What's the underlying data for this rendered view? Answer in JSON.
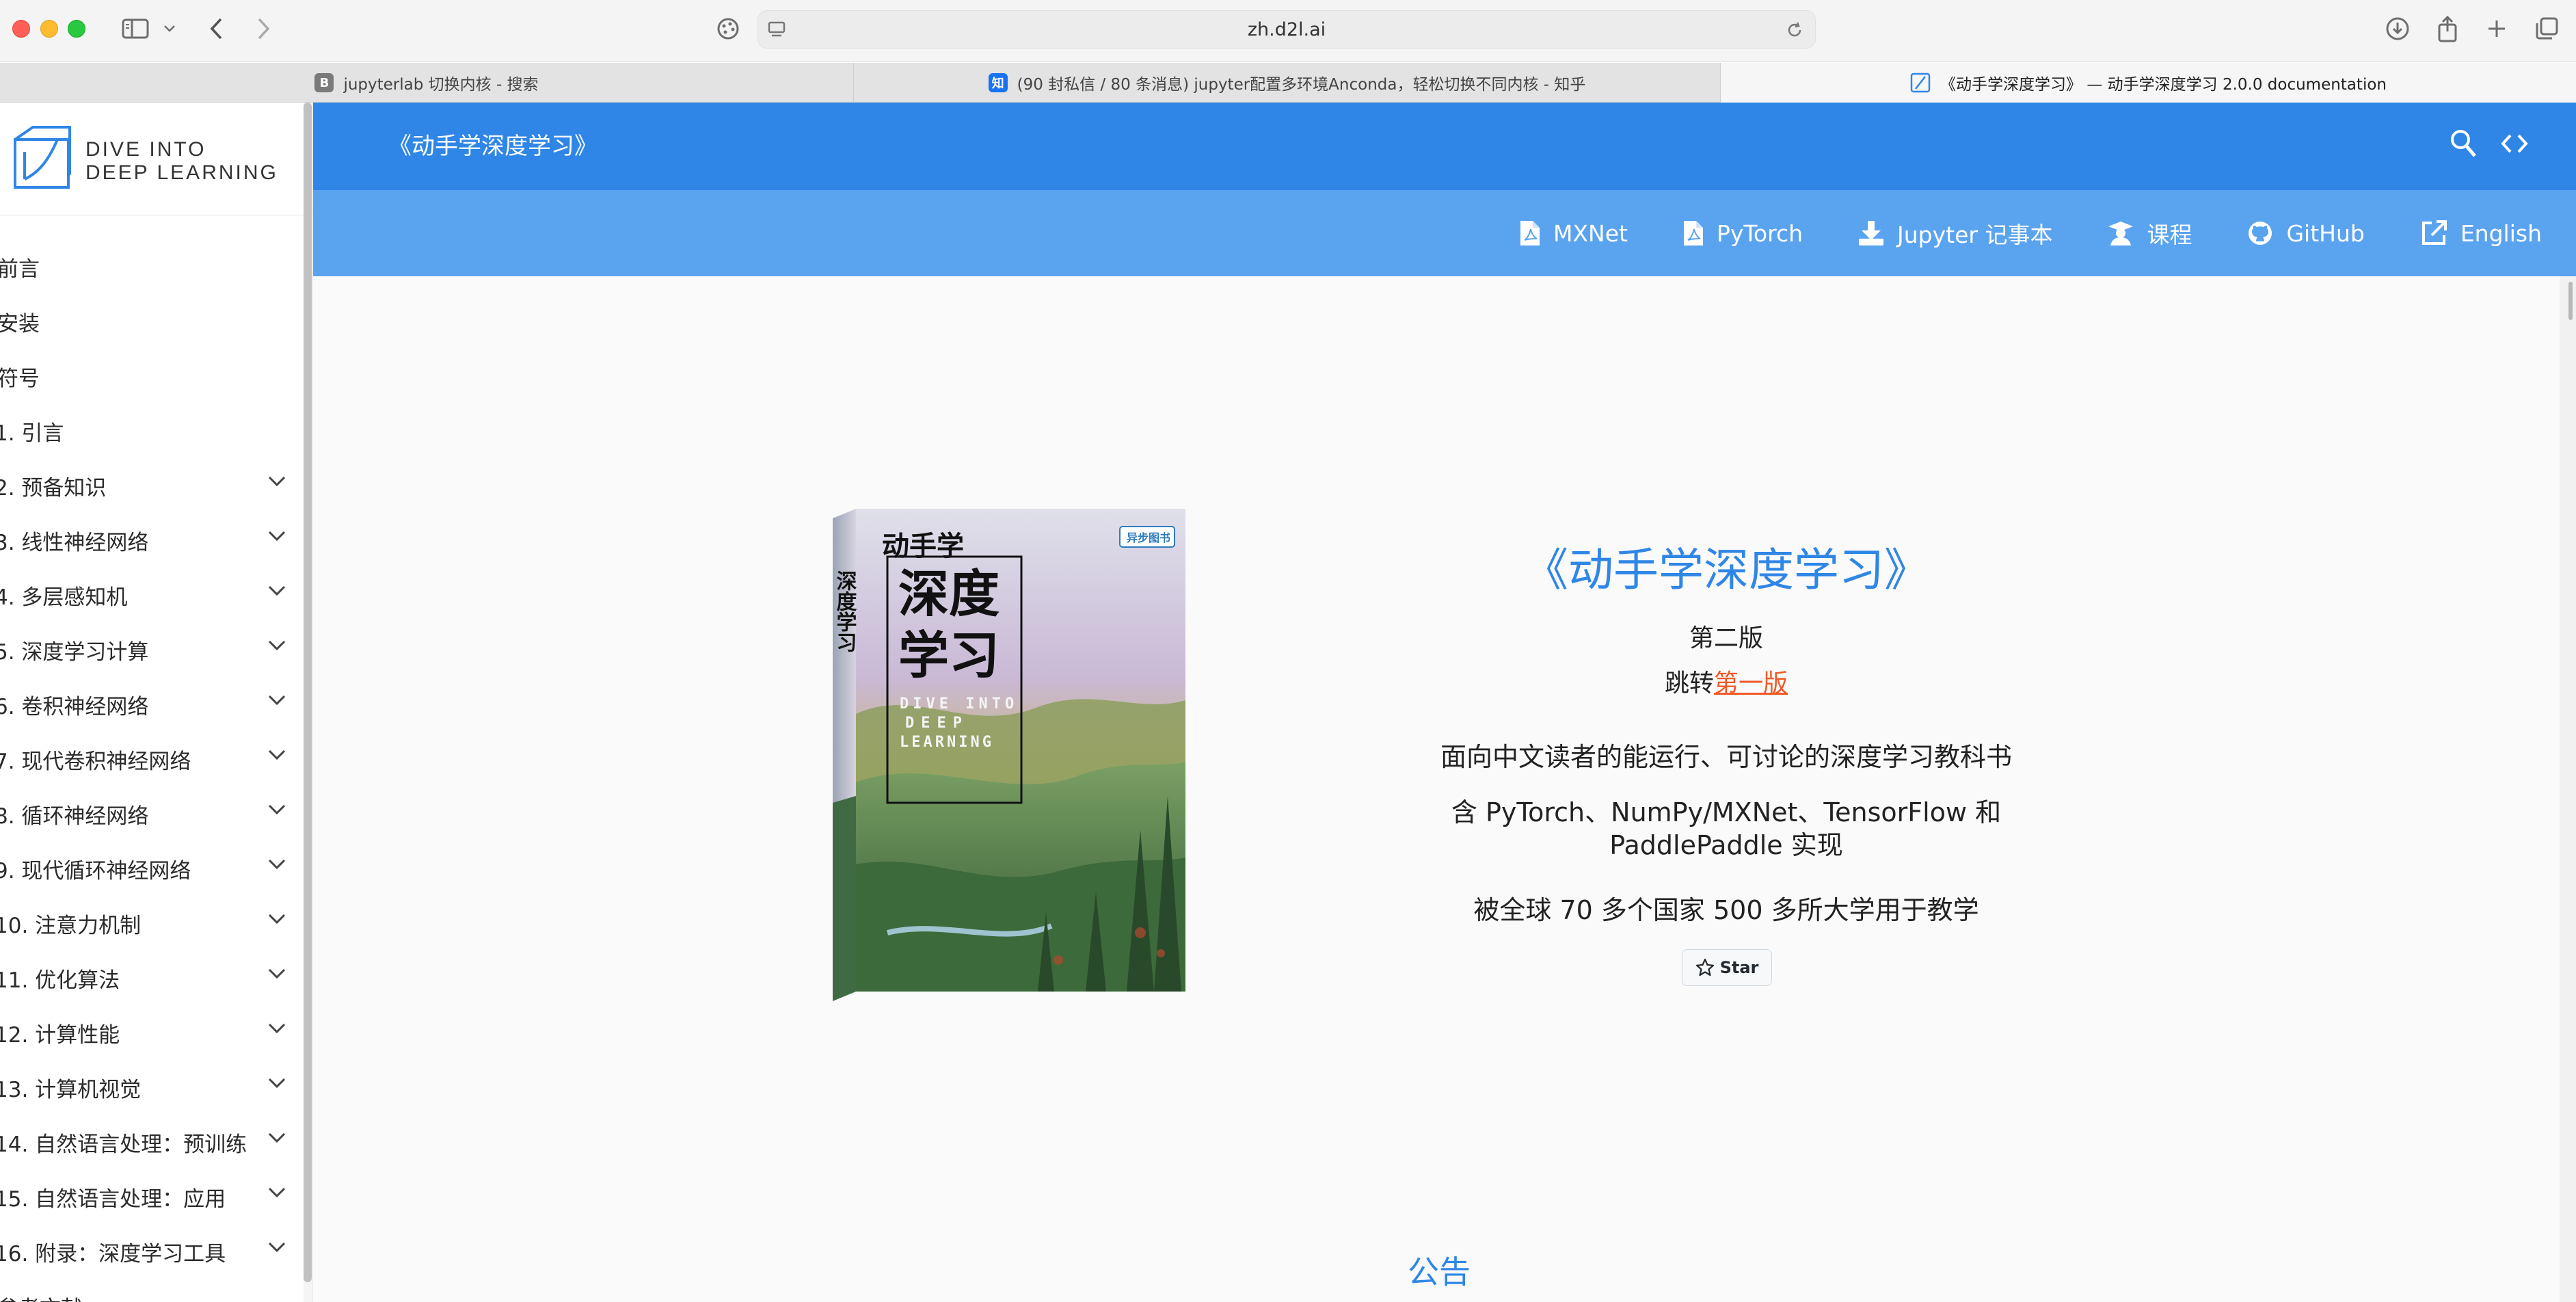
{
  "browser": {
    "url": "zh.d2l.ai",
    "tabs": [
      {
        "label": "jupyterlab 切换内核 - 搜索",
        "favicon": "B",
        "favicon_color": "#7a7a7a"
      },
      {
        "label": "(90 封私信 / 80 条消息) jupyter配置多环境Anconda，轻松切换不同内核 - 知乎",
        "favicon": "知",
        "favicon_color": "#1772f6"
      },
      {
        "label": "《动手学深度学习》 — 动手学深度学习 2.0.0 documentation",
        "favicon": "d2l-logo",
        "favicon_color": "#2f86e6"
      }
    ]
  },
  "sidebar": {
    "brand_line1": "DIVE INTO",
    "brand_line2": "DEEP LEARNING",
    "items": [
      {
        "label": "前言",
        "expandable": false
      },
      {
        "label": "安装",
        "expandable": false
      },
      {
        "label": "符号",
        "expandable": false
      },
      {
        "label": "1. 引言",
        "expandable": false
      },
      {
        "label": "2. 预备知识",
        "expandable": true
      },
      {
        "label": "3. 线性神经网络",
        "expandable": true
      },
      {
        "label": "4. 多层感知机",
        "expandable": true
      },
      {
        "label": "5. 深度学习计算",
        "expandable": true
      },
      {
        "label": "6. 卷积神经网络",
        "expandable": true
      },
      {
        "label": "7. 现代卷积神经网络",
        "expandable": true
      },
      {
        "label": "8. 循环神经网络",
        "expandable": true
      },
      {
        "label": "9. 现代循环神经网络",
        "expandable": true
      },
      {
        "label": "10. 注意力机制",
        "expandable": true
      },
      {
        "label": "11. 优化算法",
        "expandable": true
      },
      {
        "label": "12. 计算性能",
        "expandable": true
      },
      {
        "label": "13. 计算机视觉",
        "expandable": true
      },
      {
        "label": "14. 自然语言处理：预训练",
        "expandable": true
      },
      {
        "label": "15. 自然语言处理：应用",
        "expandable": true
      },
      {
        "label": "16. 附录：深度学习工具",
        "expandable": true
      },
      {
        "label": "参考文献",
        "expandable": false
      }
    ]
  },
  "header": {
    "title": "《动手学深度学习》",
    "links": [
      {
        "label": "MXNet",
        "icon": "pdf-icon"
      },
      {
        "label": "PyTorch",
        "icon": "pdf-icon"
      },
      {
        "label": "Jupyter 记事本",
        "icon": "download-icon"
      },
      {
        "label": "课程",
        "icon": "graduate-icon"
      },
      {
        "label": "GitHub",
        "icon": "github-icon"
      },
      {
        "label": "English",
        "icon": "external-link-icon"
      }
    ]
  },
  "hero": {
    "title": "《动手学深度学习》",
    "edition": "第二版",
    "jump_prefix": "跳转",
    "jump_link": "第一版",
    "tagline": "面向中文读者的能运行、可讨论的深度学习教科书",
    "impl_line1": "含 PyTorch、NumPy/MXNet、TensorFlow 和",
    "impl_line2": "PaddlePaddle 实现",
    "adoption": "被全球 70 多个国家 500 多所大学用于教学",
    "star_label": "Star",
    "book_cover": {
      "title_small": "动手学",
      "title_big_1": "深度",
      "title_big_2": "学习",
      "spine_title": "深度学习",
      "english_1": "DIVE INTO",
      "english_2": "DEEP",
      "english_3": "LEARNING",
      "publisher_badge": "异步图书"
    }
  },
  "section": {
    "notice_title": "公告"
  }
}
